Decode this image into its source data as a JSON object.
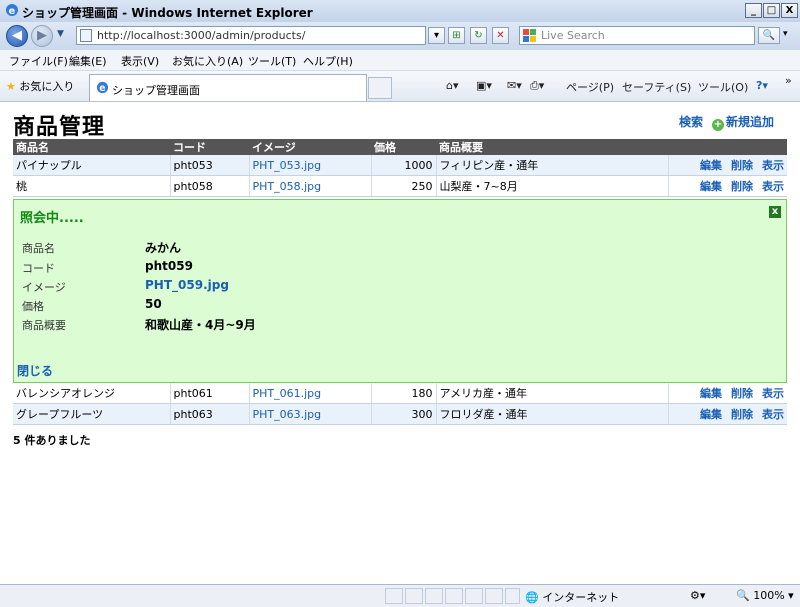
{
  "window": {
    "title": "ショップ管理画面 - Windows Internet Explorer",
    "minimize": "_",
    "maximize": "□",
    "close": "X"
  },
  "address": {
    "url": "http://localhost:3000/admin/products/",
    "search_placeholder": "Live Search"
  },
  "menu": [
    "ファイル(F)",
    "編集(E)",
    "表示(V)",
    "お気に入り(A)",
    "ツール(T)",
    "ヘルプ(H)"
  ],
  "favorites": {
    "label": "お気に入り",
    "tab_title": "ショップ管理画面",
    "commands": [
      "ページ(P)",
      "セーフティ(S)",
      "ツール(O)"
    ]
  },
  "page": {
    "title": "商品管理",
    "search_link": "検索",
    "add_link": "新規追加",
    "columns": [
      "商品名",
      "コード",
      "イメージ",
      "価格",
      "商品概要"
    ],
    "actions": [
      "編集",
      "削除",
      "表示"
    ],
    "rows_top": [
      {
        "name": "パイナップル",
        "code": "pht053",
        "image": "PHT_053.jpg",
        "price": "1000",
        "desc": "フィリピン産・通年"
      },
      {
        "name": "桃",
        "code": "pht058",
        "image": "PHT_058.jpg",
        "price": "250",
        "desc": "山梨産・7~8月"
      }
    ],
    "detail": {
      "title": "照会中.....",
      "labels": [
        "商品名",
        "コード",
        "イメージ",
        "価格",
        "商品概要"
      ],
      "name": "みかん",
      "code": "pht059",
      "image": "PHT_059.jpg",
      "price": "50",
      "desc": "和歌山産・4月~9月",
      "close": "閉じる"
    },
    "rows_bottom": [
      {
        "name": "バレンシアオレンジ",
        "code": "pht061",
        "image": "PHT_061.jpg",
        "price": "180",
        "desc": "アメリカ産・通年"
      },
      {
        "name": "グレープフルーツ",
        "code": "pht063",
        "image": "PHT_063.jpg",
        "price": "300",
        "desc": "フロリダ産・通年"
      }
    ],
    "count": "5 件ありました"
  },
  "status": {
    "zone": "インターネット",
    "zoom": "100%"
  },
  "colors": {
    "link": "#1a5fb4",
    "header_bg": "#555555",
    "detail_bg": "#dcfcd4",
    "detail_title": "#138a13"
  }
}
